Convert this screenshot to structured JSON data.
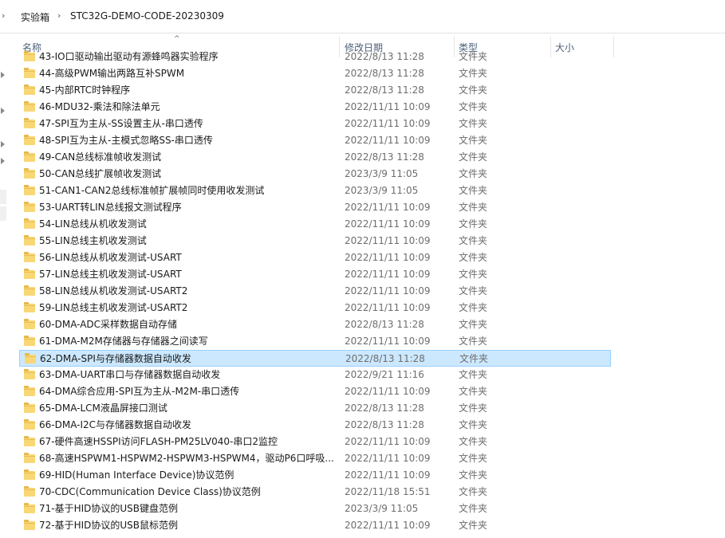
{
  "address_bar": {
    "crumbs": [
      "实验箱",
      "STC32G-DEMO-CODE-20230309"
    ]
  },
  "columns": {
    "name": "名称",
    "modified": "修改日期",
    "type": "类型",
    "size": "大小"
  },
  "rows": [
    {
      "name": "43-IO口驱动输出驱动有源蜂鸣器实验程序",
      "date": "2022/8/13 11:28",
      "type": "文件夹"
    },
    {
      "name": "44-高级PWM输出两路互补SPWM",
      "date": "2022/8/13 11:28",
      "type": "文件夹"
    },
    {
      "name": "45-内部RTC时钟程序",
      "date": "2022/8/13 11:28",
      "type": "文件夹"
    },
    {
      "name": "46-MDU32-乘法和除法单元",
      "date": "2022/11/11 10:09",
      "type": "文件夹"
    },
    {
      "name": "47-SPI互为主从-SS设置主从-串口透传",
      "date": "2022/11/11 10:09",
      "type": "文件夹"
    },
    {
      "name": "48-SPI互为主从-主模式忽略SS-串口透传",
      "date": "2022/11/11 10:09",
      "type": "文件夹"
    },
    {
      "name": "49-CAN总线标准帧收发测试",
      "date": "2022/8/13 11:28",
      "type": "文件夹"
    },
    {
      "name": "50-CAN总线扩展帧收发测试",
      "date": "2023/3/9 11:05",
      "type": "文件夹"
    },
    {
      "name": "51-CAN1-CAN2总线标准帧扩展帧同时使用收发测试",
      "date": "2023/3/9 11:05",
      "type": "文件夹"
    },
    {
      "name": "53-UART转LIN总线报文测试程序",
      "date": "2022/11/11 10:09",
      "type": "文件夹"
    },
    {
      "name": "54-LIN总线从机收发测试",
      "date": "2022/11/11 10:09",
      "type": "文件夹"
    },
    {
      "name": "55-LIN总线主机收发测试",
      "date": "2022/11/11 10:09",
      "type": "文件夹"
    },
    {
      "name": "56-LIN总线从机收发测试-USART",
      "date": "2022/11/11 10:09",
      "type": "文件夹"
    },
    {
      "name": "57-LIN总线主机收发测试-USART",
      "date": "2022/11/11 10:09",
      "type": "文件夹"
    },
    {
      "name": "58-LIN总线从机收发测试-USART2",
      "date": "2022/11/11 10:09",
      "type": "文件夹"
    },
    {
      "name": "59-LIN总线主机收发测试-USART2",
      "date": "2022/11/11 10:09",
      "type": "文件夹"
    },
    {
      "name": "60-DMA-ADC采样数据自动存储",
      "date": "2022/8/13 11:28",
      "type": "文件夹"
    },
    {
      "name": "61-DMA-M2M存储器与存储器之间读写",
      "date": "2022/11/11 10:09",
      "type": "文件夹"
    },
    {
      "name": "62-DMA-SPI与存储器数据自动收发",
      "date": "2022/8/13 11:28",
      "type": "文件夹",
      "selected": true
    },
    {
      "name": "63-DMA-UART串口与存储器数据自动收发",
      "date": "2022/9/21 11:16",
      "type": "文件夹"
    },
    {
      "name": "64-DMA综合应用-SPI互为主从-M2M-串口透传",
      "date": "2022/11/11 10:09",
      "type": "文件夹"
    },
    {
      "name": "65-DMA-LCM液晶屏接口测试",
      "date": "2022/8/13 11:28",
      "type": "文件夹"
    },
    {
      "name": "66-DMA-I2C与存储器数据自动收发",
      "date": "2022/8/13 11:28",
      "type": "文件夹"
    },
    {
      "name": "67-硬件高速HSSPI访问FLASH-PM25LV040-串口2监控",
      "date": "2022/11/11 10:09",
      "type": "文件夹"
    },
    {
      "name": "68-高速HSPWM1-HSPWM2-HSPWM3-HSPWM4，驱动P6口呼吸...",
      "date": "2022/11/11 10:09",
      "type": "文件夹"
    },
    {
      "name": "69-HID(Human Interface Device)协议范例",
      "date": "2022/11/11 10:09",
      "type": "文件夹"
    },
    {
      "name": "70-CDC(Communication Device Class)协议范例",
      "date": "2022/11/18 15:51",
      "type": "文件夹"
    },
    {
      "name": "71-基于HID协议的USB键盘范例",
      "date": "2023/3/9 11:05",
      "type": "文件夹"
    },
    {
      "name": "72-基于HID协议的USB鼠标范例",
      "date": "2022/11/11 10:09",
      "type": "文件夹"
    }
  ]
}
